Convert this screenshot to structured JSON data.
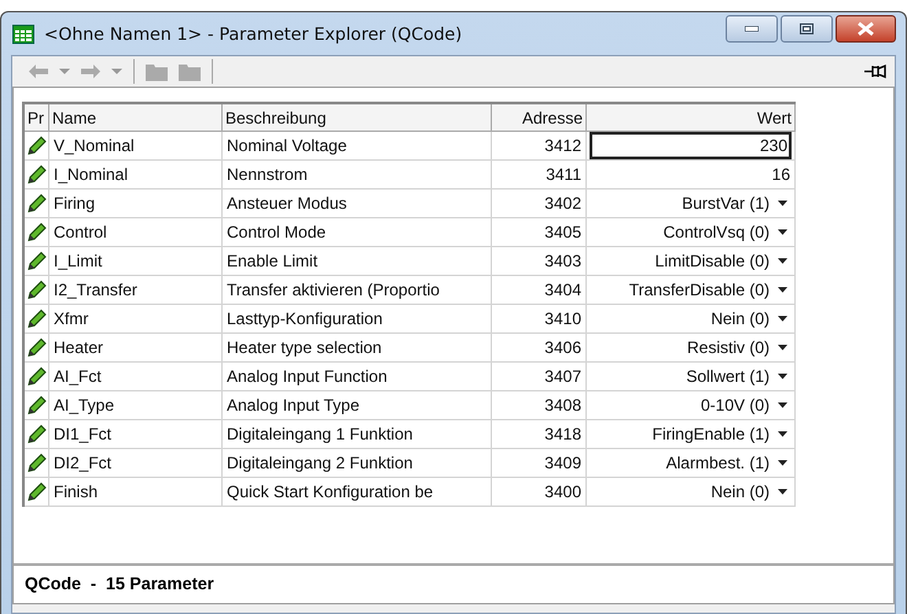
{
  "window": {
    "title": "<Ohne Namen 1> - Parameter Explorer (QCode)"
  },
  "table": {
    "columns": [
      "Pr",
      "Name",
      "Beschreibung",
      "Adresse",
      "Wert"
    ],
    "rows": [
      {
        "name": "V_Nominal",
        "description": "Nominal Voltage",
        "address": "3412",
        "value": "230",
        "kind": "edit"
      },
      {
        "name": "I_Nominal",
        "description": "Nennstrom",
        "address": "3411",
        "value": "16",
        "kind": "text"
      },
      {
        "name": "Firing",
        "description": "Ansteuer Modus",
        "address": "3402",
        "value": "BurstVar (1)",
        "kind": "dropdown"
      },
      {
        "name": "Control",
        "description": "Control Mode",
        "address": "3405",
        "value": "ControlVsq (0)",
        "kind": "dropdown"
      },
      {
        "name": "I_Limit",
        "description": "Enable Limit",
        "address": "3403",
        "value": "LimitDisable (0)",
        "kind": "dropdown"
      },
      {
        "name": "I2_Transfer",
        "description": "Transfer aktivieren (Proportio",
        "address": "3404",
        "value": "TransferDisable (0)",
        "kind": "dropdown"
      },
      {
        "name": "Xfmr",
        "description": "Lasttyp-Konfiguration",
        "address": "3410",
        "value": "Nein (0)",
        "kind": "dropdown"
      },
      {
        "name": "Heater",
        "description": "Heater type selection",
        "address": "3406",
        "value": "Resistiv (0)",
        "kind": "dropdown"
      },
      {
        "name": "AI_Fct",
        "description": "Analog Input Function",
        "address": "3407",
        "value": "Sollwert (1)",
        "kind": "dropdown"
      },
      {
        "name": "AI_Type",
        "description": "Analog Input Type",
        "address": "3408",
        "value": "0-10V (0)",
        "kind": "dropdown"
      },
      {
        "name": "DI1_Fct",
        "description": "Digitaleingang 1 Funktion",
        "address": "3418",
        "value": "FiringEnable (1)",
        "kind": "dropdown"
      },
      {
        "name": "DI2_Fct",
        "description": "Digitaleingang 2 Funktion",
        "address": "3409",
        "value": "Alarmbest. (1)",
        "kind": "dropdown"
      },
      {
        "name": "Finish",
        "description": "Quick Start Konfiguration be",
        "address": "3400",
        "value": "Nein (0)",
        "kind": "dropdown"
      }
    ]
  },
  "status_bar": "QCode  -  15 Parameter"
}
